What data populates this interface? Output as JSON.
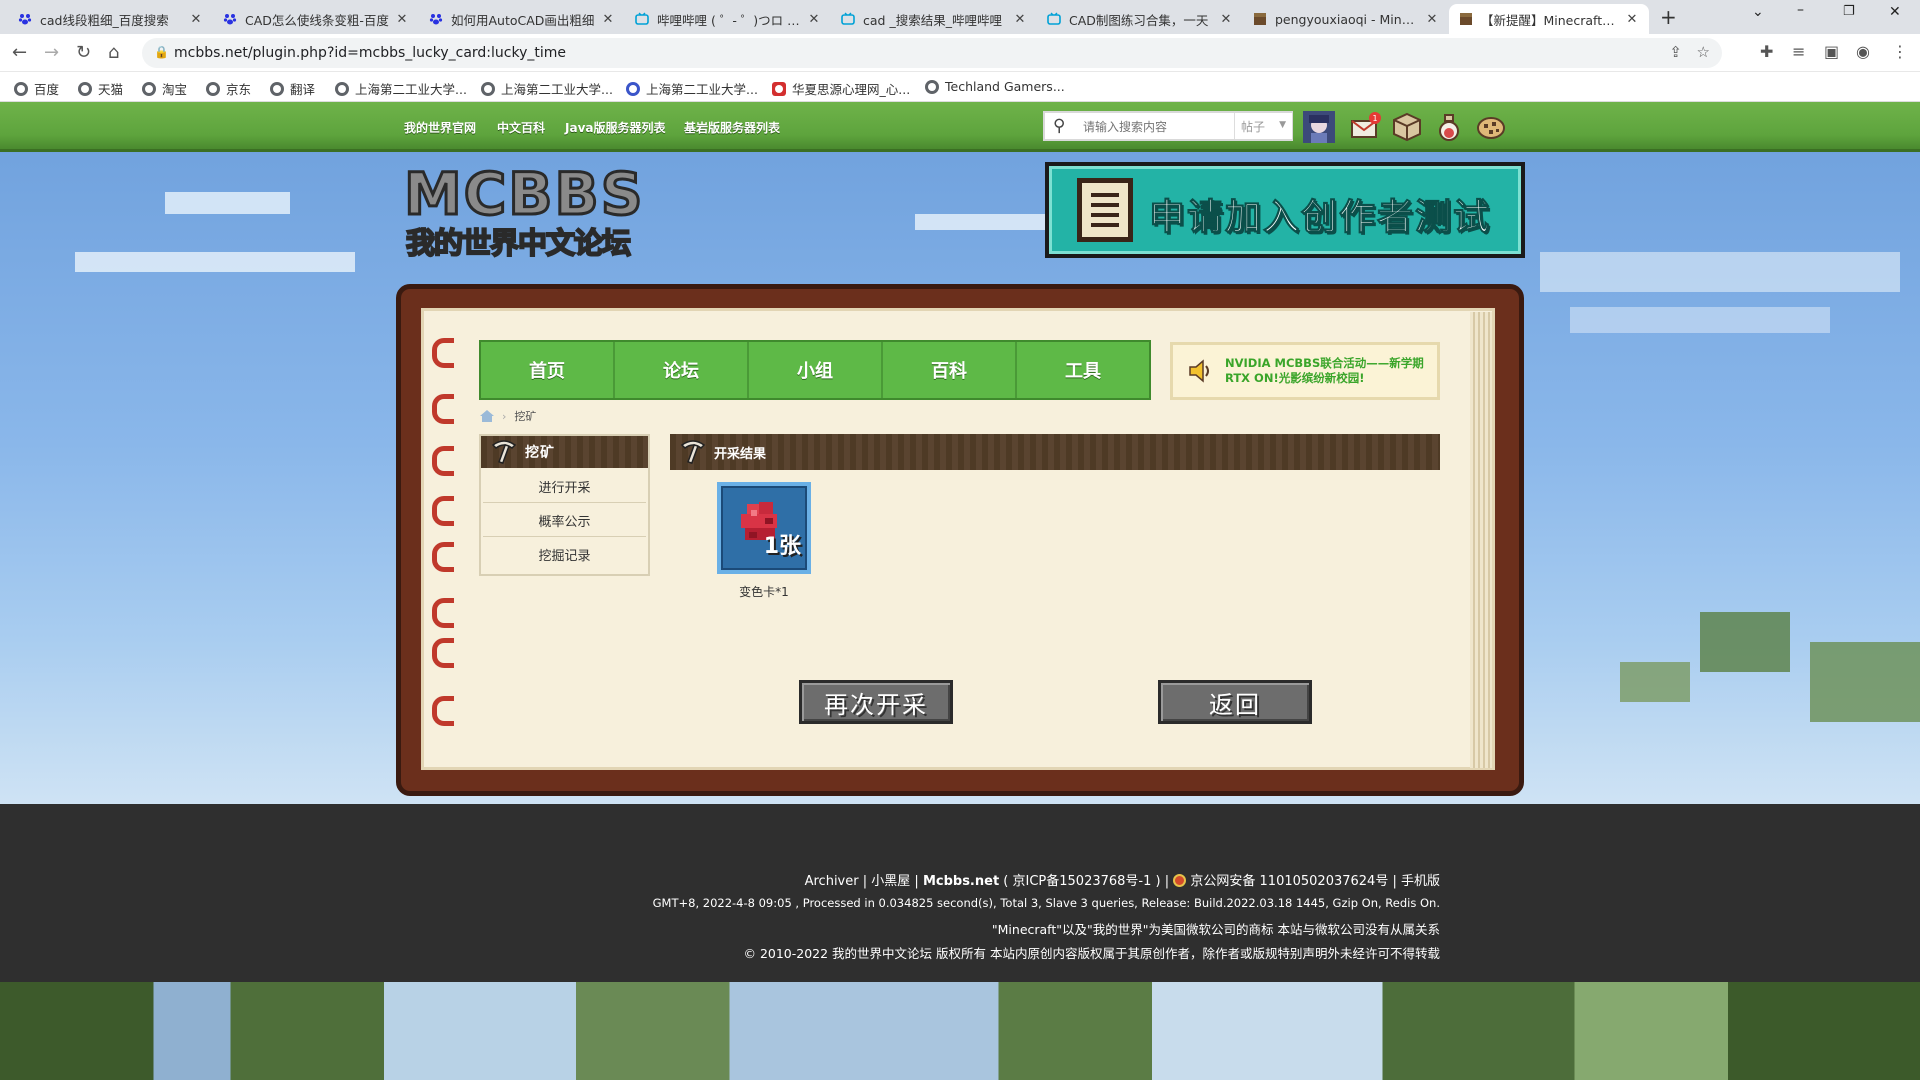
{
  "browser": {
    "tabs": [
      {
        "title": "cad线段粗细_百度搜索",
        "favicon": "paw-icon",
        "active": false
      },
      {
        "title": "CAD怎么使线条变粗-百度",
        "favicon": "paw-icon",
        "active": false
      },
      {
        "title": "如何用AutoCAD画出粗细",
        "favicon": "paw-icon",
        "active": false
      },
      {
        "title": "哔哩哔哩 ( ゜- ゜)つロ 干杯",
        "favicon": "tv-icon",
        "active": false
      },
      {
        "title": "cad _搜索结果_哔哩哔哩",
        "favicon": "tv-icon",
        "active": false
      },
      {
        "title": "CAD制图练习合集，一天",
        "favicon": "tv-icon",
        "active": false
      },
      {
        "title": "pengyouxiaoqi - Minecra",
        "favicon": "block-icon",
        "active": false
      },
      {
        "title": "【新提醒】Minecraft(我的",
        "favicon": "block-icon",
        "active": true
      }
    ],
    "url": "mcbbs.net/plugin.php?id=mcbbs_lucky_card:lucky_time",
    "bookmarks": [
      {
        "label": "百度",
        "icon": "globe-icon"
      },
      {
        "label": "天猫",
        "icon": "globe-icon"
      },
      {
        "label": "淘宝",
        "icon": "globe-icon"
      },
      {
        "label": "京东",
        "icon": "globe-icon"
      },
      {
        "label": "翻译",
        "icon": "globe-icon"
      },
      {
        "label": "上海第二工业大学...",
        "icon": "globe-icon"
      },
      {
        "label": "上海第二工业大学...",
        "icon": "globe-icon"
      },
      {
        "label": "上海第二工业大学...",
        "icon": "school-icon"
      },
      {
        "label": "华夏思源心理网_心...",
        "icon": "flame-icon"
      },
      {
        "label": "Techland Gamers...",
        "icon": "globe-icon"
      }
    ]
  },
  "header": {
    "links": [
      "我的世界官网",
      "中文百科",
      "Java版服务器列表",
      "基岩版服务器列表"
    ],
    "search_placeholder": "请输入搜索内容",
    "search_scope": "帖子",
    "notification_badge": "1"
  },
  "logo": {
    "line1": "MCBBS",
    "line2": "我的世界中文论坛"
  },
  "banner": {
    "text": "申请加入创作者测试"
  },
  "mainnav": [
    "首页",
    "论坛",
    "小组",
    "百科",
    "工具"
  ],
  "notice": {
    "line1": "NVIDIA MCBBS联合活动——新学期",
    "line2": "RTX ON!光影缤纷新校园!"
  },
  "breadcrumb": {
    "current": "挖矿"
  },
  "sidebar": {
    "title": "挖矿",
    "items": [
      "进行开采",
      "概率公示",
      "挖掘记录"
    ]
  },
  "result": {
    "title": "开采结果",
    "card_count": "1张",
    "card_label": "变色卡*1"
  },
  "buttons": {
    "again": "再次开采",
    "back": "返回"
  },
  "footer": {
    "line1": {
      "archiver": "Archiver",
      "blackroom": "小黑屋",
      "site": "Mcbbs.net",
      "icp": "( 京ICP备15023768号-1 )",
      "police": "京公网安备 11010502037624号",
      "mobile": "手机版"
    },
    "line2": "GMT+8, 2022-4-8 09:05 , Processed in 0.034825 second(s), Total 3, Slave 3 queries, Release: Build.2022.03.18 1445, Gzip On, Redis On.",
    "line3": "\"Minecraft\"以及\"我的世界\"为美国微软公司的商标 本站与微软公司没有从属关系",
    "line4": "© 2010-2022 我的世界中文论坛 版权所有 本站内原创内容版权属于其原创作者，除作者或版规特别声明外未经许可不得转载"
  },
  "colors": {
    "nav_green": "#5eb947",
    "frame_brown": "#6b2f1c",
    "paper": "#f7f0dc",
    "notice_green": "#3aa52a"
  }
}
